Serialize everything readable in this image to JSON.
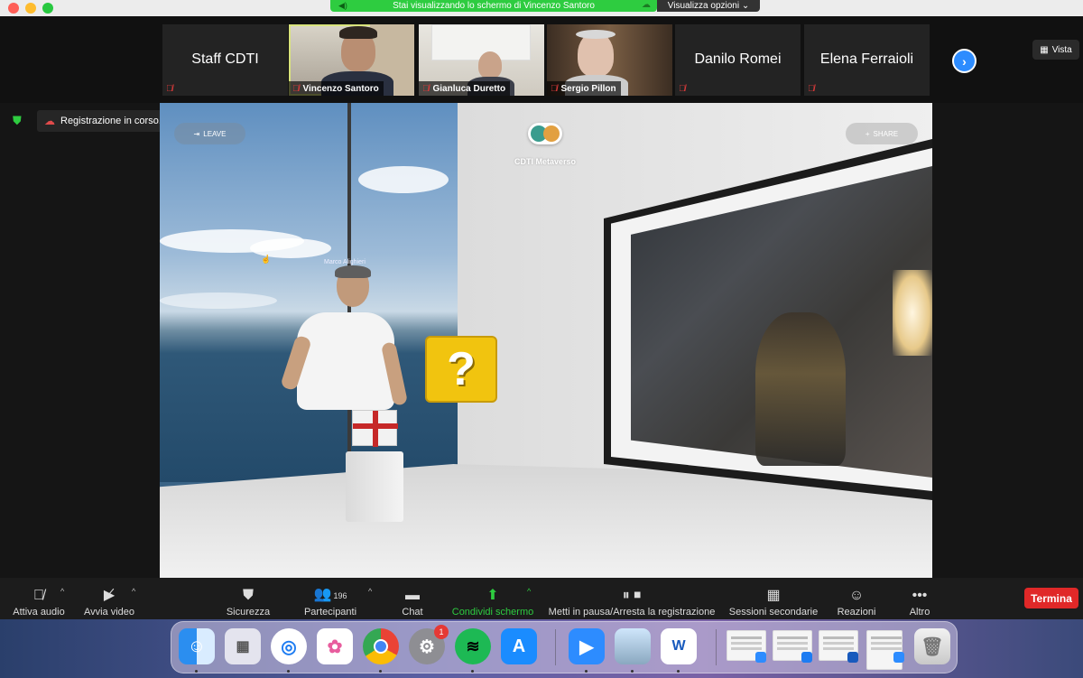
{
  "banner": {
    "text": "Stai visualizzando lo schermo di Vincenzo Santoro",
    "view_options": "Visualizza opzioni ⌄"
  },
  "view_button": "Vista",
  "participants": [
    {
      "name": "Staff CDTI"
    },
    {
      "name": "Vincenzo Santoro"
    },
    {
      "name": "Gianluca Duretto"
    },
    {
      "name": "Sergio Pillon"
    },
    {
      "name": "Danilo Romei"
    },
    {
      "name": "Elena Ferraioli"
    }
  ],
  "recording": {
    "text": "Registrazione in corso..."
  },
  "shared_screen": {
    "leave": "LEAVE",
    "share": "SHARE",
    "space_title": "CDTI Metaverso",
    "avatar_tag": "Marco Alighieri",
    "block_symbol": "?"
  },
  "toolbar": {
    "audio": "Attiva audio",
    "video": "Avvia video",
    "security": "Sicurezza",
    "participants": "Partecipanti",
    "participants_count": "196",
    "chat": "Chat",
    "share_screen": "Condividi schermo",
    "recording": "Metti in pausa/Arresta la registrazione",
    "breakout": "Sessioni secondarie",
    "reactions": "Reazioni",
    "more": "Altro",
    "end": "Termina"
  },
  "dock": {
    "settings_badge": "1",
    "word_letter": "W"
  },
  "colors": {
    "zoom_green": "#2ecc40",
    "zoom_blue": "#2d8cff",
    "end_red": "#e02828"
  }
}
